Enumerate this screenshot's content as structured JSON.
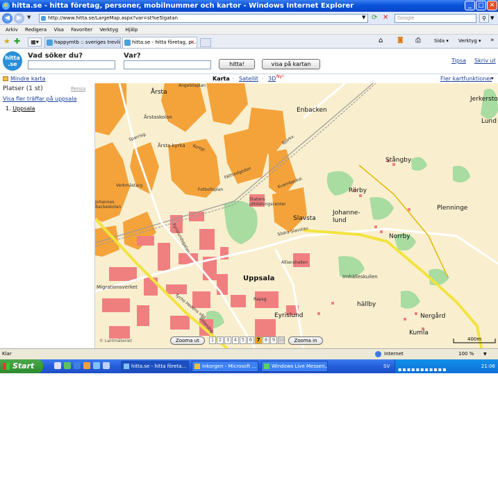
{
  "window": {
    "title": "hitta.se - hitta företag, personer, mobilnummer och kartor - Windows Internet Explorer"
  },
  "browser": {
    "address": "http://www.hitta.se/LargeMap.aspx?var=st%e5lgatan",
    "search_placeholder": "Google",
    "menu": [
      "Arkiv",
      "Redigera",
      "Visa",
      "Favoriter",
      "Verktyg",
      "Hjälp"
    ],
    "tabs": [
      {
        "label": "happymtb :: sveriges trevlig..."
      },
      {
        "label": "hitta.se - hitta företag, p..."
      }
    ],
    "tools": {
      "page": "Sida",
      "tools": "Verktyg"
    }
  },
  "site": {
    "logo": "hitta .se",
    "what_label": "Vad söker du?",
    "where_label": "Var?",
    "search_button": "hitta!",
    "map_button": "visa på kartan",
    "tipsa": "Tipsa",
    "print": "Skriv ut"
  },
  "map_toolbar": {
    "smaller_map": "Mindre karta",
    "view_map": "Karta",
    "view_satellite": "Satellit",
    "view_3d": "3D",
    "new_badge": "Ny!",
    "more_functions": "Fler kartfunktioner"
  },
  "sidebar": {
    "heading": "Platser (1 st)",
    "clear": "Rensa",
    "more_link": "Visa fler träffar på uppsala",
    "results": [
      {
        "num": "1.",
        "label": "Uppsala"
      }
    ]
  },
  "map": {
    "labels": {
      "enbacken": "Enbacken",
      "jerkerstorp": "Jerkerstorp",
      "lund": "Lund",
      "arsta": "Årsta",
      "arstaskolan": "Årstaskolan",
      "arsta_kyrka": "Årsta kyrka",
      "stangby": "Stångby",
      "rorby": "Rörby",
      "johannelund": "Johanne-\nlund",
      "plenninge": "Plenninge",
      "slavsta": "Slavsta",
      "norrby": "Norrby",
      "uppsala": "Uppsala",
      "irnhalleskullen": "Irnhälleskullen",
      "hallby": "hällby",
      "nergard": "Nergård",
      "eyrislund": "Eyrislund",
      "kumla": "Kumla",
      "fyrislundsgatan": "Fyrislundsgatan",
      "sodra_slavstav": "Södra Slavstav.",
      "allianshallen": "Allianshallen",
      "migrationsverket": "Migrationsverket",
      "tycho_hedens_vag": "Tycho Hedéns väg",
      "bolandsg": "Bolandsg",
      "rapsg": "Rapsg.",
      "verkmastarg": "Verkmästarg.",
      "statens_utbildningscenter": "Statens\nutbildningscenter",
      "fathedgeden": "Fälthedgeden",
      "bjorkvagen": "Björkv.",
      "kvarnbacksl": "Kvarnbacksl.",
      "angelstaplan": "Angelstaplan",
      "sparrisg": "Sparrisg.",
      "kortgr": "Kortgr.",
      "johannes_backeskolan": "Johannes\nBackeskolan",
      "fotbollsplan": "Fotbollsplan"
    },
    "zoom_out": "Zooma ut",
    "zoom_in": "Zooma in",
    "zoom_levels": [
      "1",
      "2",
      "3",
      "4",
      "5",
      "6",
      "7",
      "8",
      "9",
      "10"
    ],
    "zoom_current": "7",
    "scale": "400m",
    "copyright": "© Lantmäteriet"
  },
  "status": {
    "left": "Klar",
    "zone": "Internet",
    "zoom": "100 %"
  },
  "taskbar": {
    "start": "Start",
    "tasks": [
      {
        "label": "hitta.se - hitta företa..."
      },
      {
        "label": "Inkorgen - Microsoft ..."
      },
      {
        "label": "Windows Live Messen..."
      }
    ],
    "lang": "SV",
    "time": "21:06"
  },
  "colors": {
    "xp_blue": "#0a53d9",
    "urban_orange": "#f4a33a",
    "industrial_red": "#f08080",
    "forest_green": "#a8dca0",
    "road_yellow": "#f2e340",
    "map_bg": "#f9efcf"
  }
}
